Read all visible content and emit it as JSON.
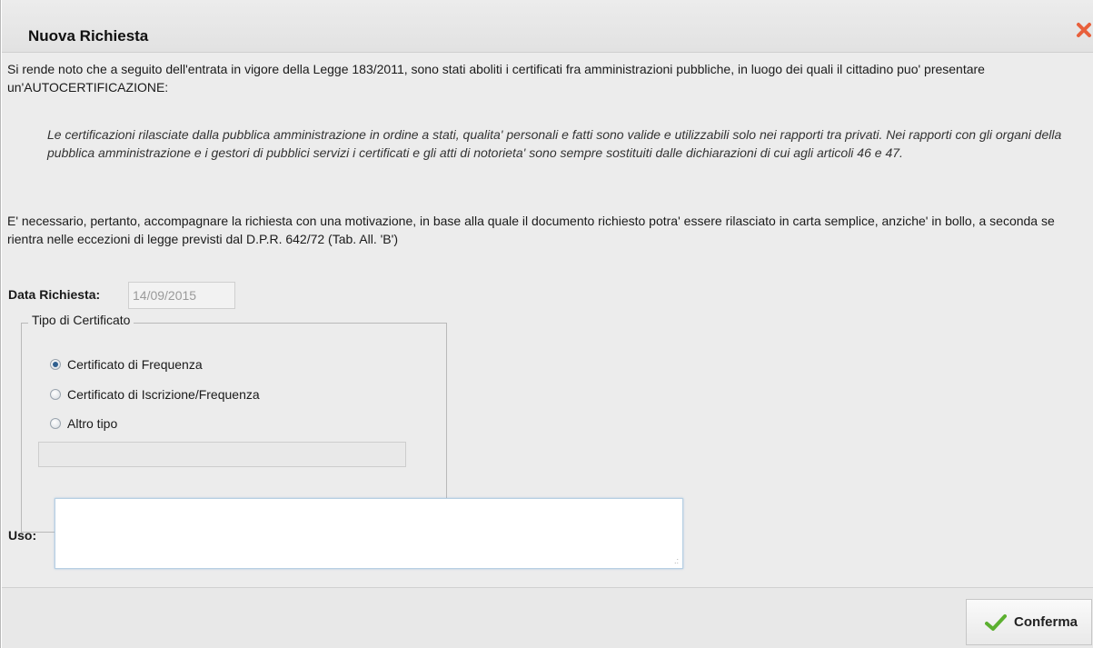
{
  "dialog": {
    "title": "Nuova Richiesta"
  },
  "content": {
    "intro": "Si rende noto che a seguito dell'entrata in vigore della Legge 183/2011, sono stati aboliti i certificati fra amministrazioni pubbliche, in luogo dei quali il cittadino puo' presentare un'AUTOCERTIFICAZIONE:",
    "quote": "Le certificazioni rilasciate dalla pubblica amministrazione in ordine a stati, qualita' personali e fatti sono valide e utilizzabili solo nei rapporti tra privati. Nei rapporti con gli organi della pubblica amministrazione e i gestori di pubblici servizi i certificati e gli atti di notorieta' sono sempre sostituiti dalle dichiarazioni di cui agli articoli 46 e 47.",
    "note": "E' necessario, pertanto, accompagnare la richiesta con una motivazione, in base alla quale il documento richiesto potra' essere rilasciato in carta semplice, anziche' in bollo, a seconda se rientra nelle eccezioni di legge previsti dal D.P.R. 642/72 (Tab. All. 'B')"
  },
  "form": {
    "date_label": "Data Richiesta:",
    "date_value": "14/09/2015",
    "certificate_group_label": "Tipo di Certificato",
    "options": [
      {
        "label": "Certificato di Frequenza",
        "checked": true
      },
      {
        "label": "Certificato di Iscrizione/Frequenza",
        "checked": false
      },
      {
        "label": "Altro tipo",
        "checked": false
      }
    ],
    "other_value": "",
    "uso_label": "Uso:",
    "uso_value": ""
  },
  "footer": {
    "confirm_label": "Conferma"
  },
  "colors": {
    "close_icon": "#e8603c",
    "check_icon": "#5cb030",
    "background": "#ececec"
  }
}
